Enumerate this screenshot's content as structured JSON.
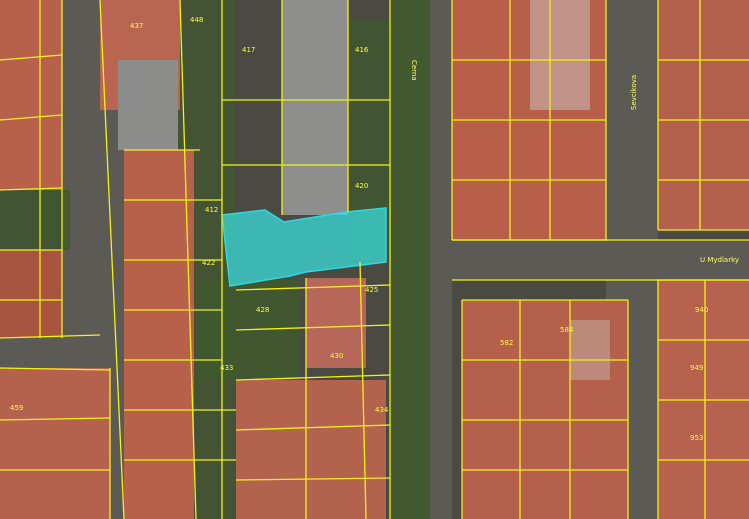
{
  "map": {
    "type": "cadastral-orthophoto",
    "colors": {
      "parcel_line": "#f2f21a",
      "highlight_fill": "#37e6e6",
      "highlight_stroke": "#2fd8e0",
      "roof": "#b8614a",
      "greenery": "#3f5a2c",
      "street": "#5b5a54"
    },
    "parcel_numbers": [
      {
        "id": "p417",
        "text": "417"
      },
      {
        "id": "p416",
        "text": "416"
      },
      {
        "id": "p412",
        "text": "412"
      },
      {
        "id": "p420",
        "text": "420"
      },
      {
        "id": "p422",
        "text": "422"
      },
      {
        "id": "p425",
        "text": "425"
      },
      {
        "id": "p428",
        "text": "428"
      },
      {
        "id": "p430",
        "text": "430"
      },
      {
        "id": "p433",
        "text": "433"
      },
      {
        "id": "p434",
        "text": "434"
      },
      {
        "id": "p582",
        "text": "582"
      },
      {
        "id": "p584",
        "text": "584"
      },
      {
        "id": "p940",
        "text": "940"
      },
      {
        "id": "p949",
        "text": "949"
      },
      {
        "id": "p953",
        "text": "953"
      },
      {
        "id": "p459",
        "text": "459"
      },
      {
        "id": "p437",
        "text": "437"
      },
      {
        "id": "p448",
        "text": "448"
      }
    ],
    "street_labels": [
      {
        "id": "s1",
        "text": "U Mydlarky"
      },
      {
        "id": "s2",
        "text": "Sevcikova"
      },
      {
        "id": "s3",
        "text": "Cerna"
      }
    ]
  }
}
